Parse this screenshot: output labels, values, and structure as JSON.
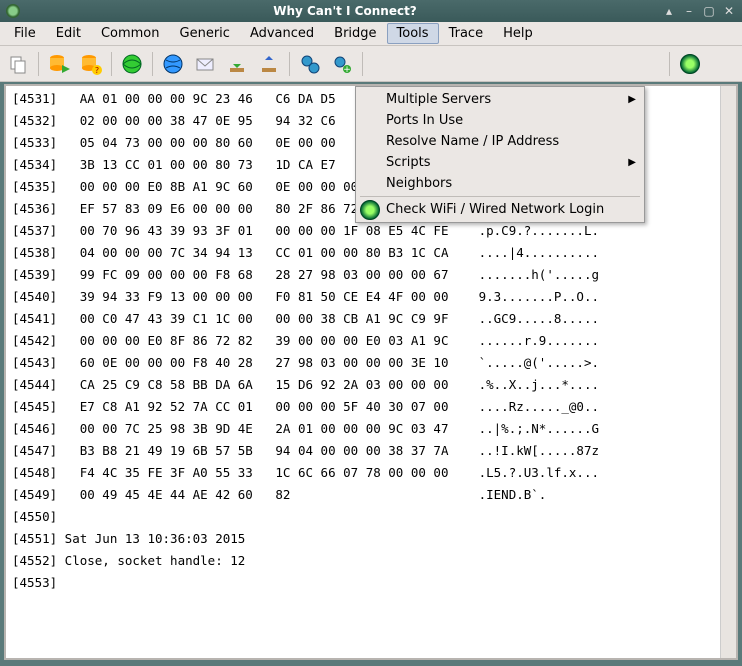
{
  "titlebar": {
    "title": "Why Can't I Connect?"
  },
  "menubar": {
    "items": [
      {
        "label": "File"
      },
      {
        "label": "Edit"
      },
      {
        "label": "Common"
      },
      {
        "label": "Generic"
      },
      {
        "label": "Advanced"
      },
      {
        "label": "Bridge"
      },
      {
        "label": "Tools"
      },
      {
        "label": "Trace"
      },
      {
        "label": "Help"
      }
    ],
    "active_index": 6
  },
  "dropdown": {
    "items": [
      {
        "label": "Multiple Servers",
        "submenu": true
      },
      {
        "label": "Ports In Use"
      },
      {
        "label": "Resolve Name / IP Address"
      },
      {
        "label": "Scripts",
        "submenu": true
      },
      {
        "label": "Neighbors"
      }
    ],
    "sep_after": 4,
    "check_item": {
      "label": "Check WiFi / Wired Network Login"
    }
  },
  "log_lines": [
    "[4531]   AA 01 00 00 00 9C 23 46   C6 DA D5",
    "[4532]   02 00 00 00 38 47 0E 95   94 32 C6",
    "[4533]   05 04 73 00 00 00 80 60   0E 00 00",
    "[4534]   3B 13 CC 01 00 00 80 73   1D CA E7",
    "[4535]   00 00 00 E0 8B A1 9C 60   0E 00 00 00 9C E5 50 DE    .............P.",
    "[4536]   EF 57 83 09 E6 00 00 00   80 2F 86 72 82 39 00 00    .W......./.r.9..",
    "[4537]   00 70 96 43 39 93 3F 01   00 00 00 1F 08 E5 4C FE    .p.C9.?.......L.",
    "[4538]   04 00 00 00 7C 34 94 13   CC 01 00 00 80 B3 1C CA    ....|4..........",
    "[4539]   99 FC 09 00 00 00 F8 68   28 27 98 03 00 00 00 67    .......h('.....g",
    "[4540]   39 94 33 F9 13 00 00 00   F0 81 50 CE E4 4F 00 00    9.3.......P..O..",
    "[4541]   00 C0 47 43 39 C1 1C 00   00 00 38 CB A1 9C C9 9F    ..GC9.....8.....",
    "[4542]   00 00 00 E0 8F 86 72 82   39 00 00 00 E0 03 A1 9C    ......r.9.......",
    "[4543]   60 0E 00 00 00 F8 40 28   27 98 03 00 00 00 3E 10    `.....@('.....>.",
    "[4544]   CA 25 C9 C8 58 BB DA 6A   15 D6 92 2A 03 00 00 00    .%..X..j...*....",
    "[4545]   E7 C8 A1 92 52 7A CC 01   00 00 00 5F 40 30 07 00    ....Rz....._@0..",
    "[4546]   00 00 7C 25 98 3B 9D 4E   2A 01 00 00 00 9C 03 47    ..|%.;.N*......G",
    "[4547]   B3 B8 21 49 19 6B 57 5B   94 04 00 00 00 38 37 7A    ..!I.kW[.....87z",
    "[4548]   F4 4C 35 FE 3F A0 55 33   1C 6C 66 07 78 00 00 00    .L5.?.U3.lf.x...",
    "[4549]   00 49 45 4E 44 AE 42 60   82                         .IEND.B`.",
    "[4550]",
    "[4551] Sat Jun 13 10:36:03 2015",
    "[4552] Close, socket handle: 12",
    "[4553]"
  ]
}
